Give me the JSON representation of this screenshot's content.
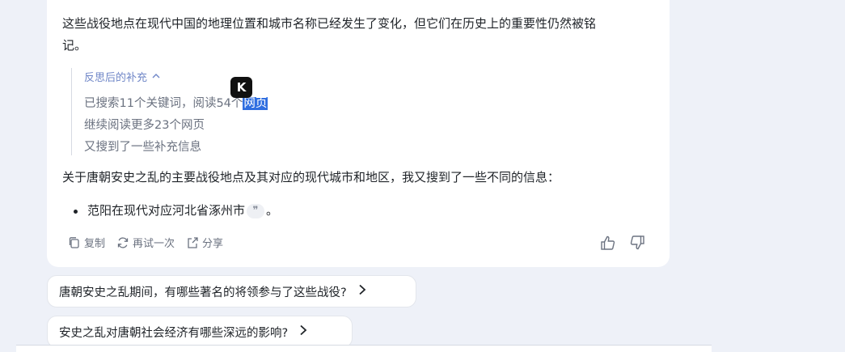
{
  "answer": {
    "para1_line1": "这些战役地点在现代中国的地理位置和城市名称已经发生了变化，但它们在历史上的重要性仍然被铭",
    "para1_line2": "记。",
    "supplement": {
      "title": "反思后的补充",
      "line1_pre": "已搜索11个关键词，阅读54个",
      "line1_hl": "网页",
      "line2": "继续阅读更多23个网页",
      "line3": "又搜到了一些补充信息"
    },
    "para2": "关于唐朝安史之乱的主要战役地点及其对应的现代城市和地区，我又搜到了一些不同的信息：",
    "bullet1": "范阳在现代对应河北省涿州市",
    "bullet1_tail": "。",
    "badge_letter": "K"
  },
  "actions": {
    "copy": "复制",
    "retry": "再试一次",
    "share": "分享"
  },
  "suggestions": [
    "唐朝安史之乱期间，有哪些著名的将领参与了这些战役?",
    "安史之乱对唐朝社会经济有哪些深远的影响?"
  ],
  "colors": {
    "accent": "#2f6ee0",
    "supplement_title": "#6f86c7",
    "background": "#eef1f8"
  }
}
